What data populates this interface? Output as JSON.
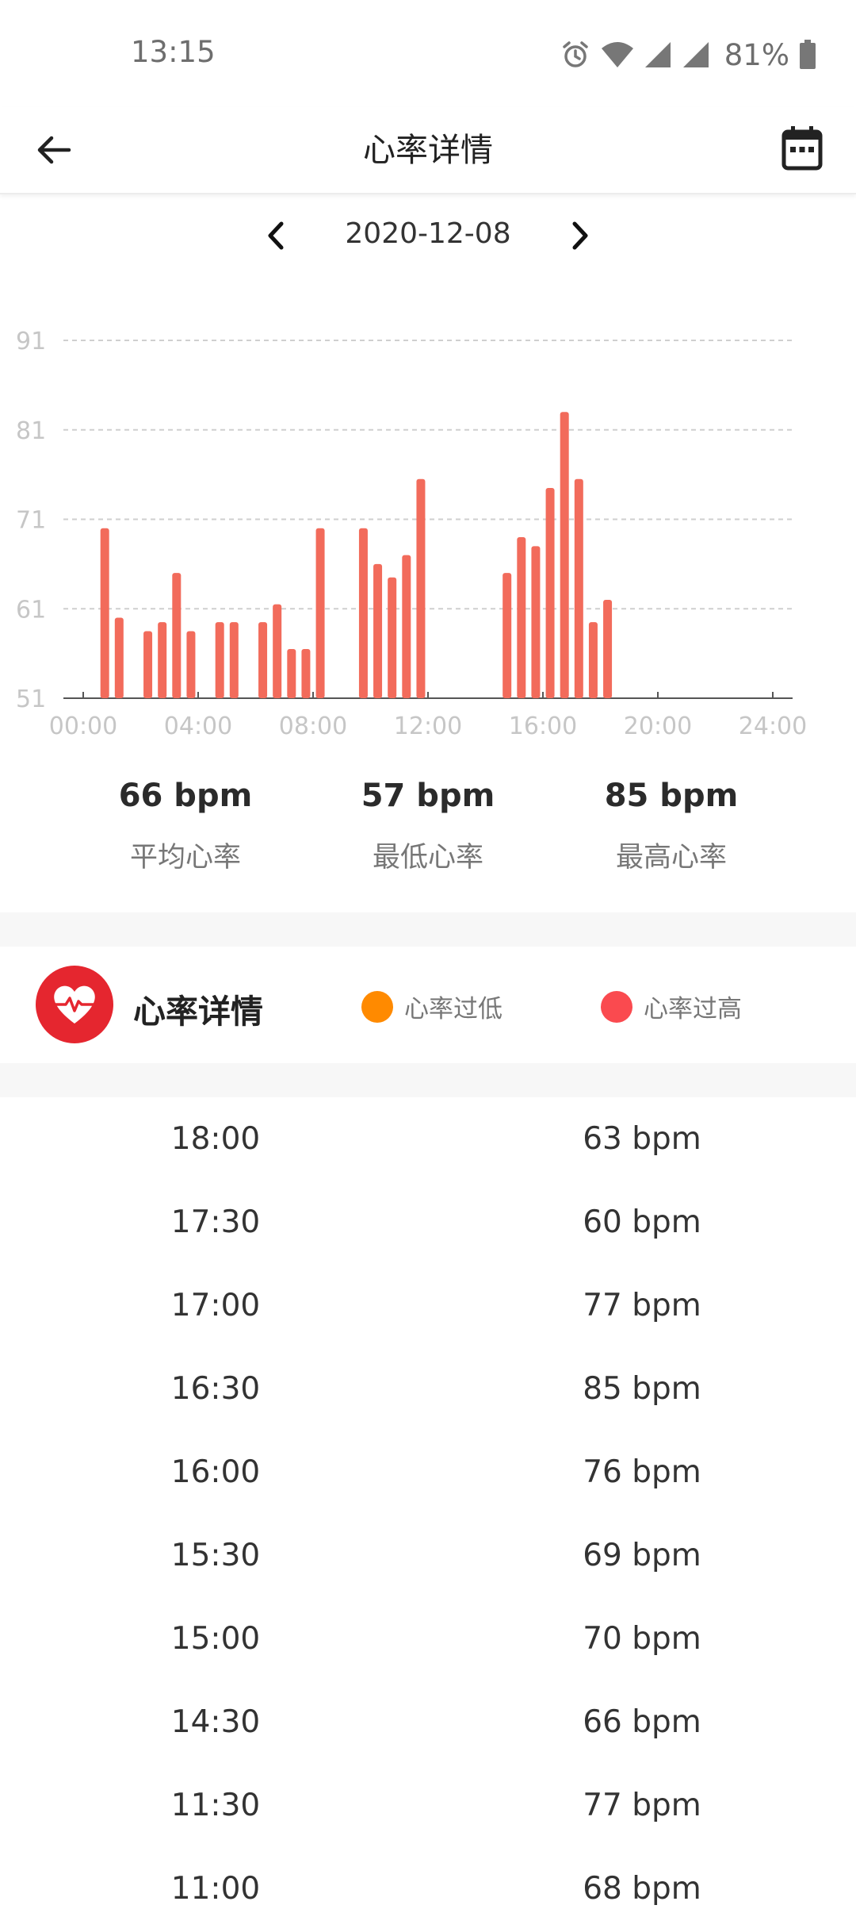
{
  "status_bar": {
    "time": "13:15",
    "battery": "81%",
    "icons": [
      "alarm-icon",
      "wifi-icon",
      "signal-icon",
      "signal-icon",
      "battery-icon"
    ]
  },
  "app_bar": {
    "title": "心率详情",
    "back_icon": "arrow-left-icon",
    "calendar_icon": "calendar-icon"
  },
  "date_nav": {
    "date": "2020-12-08",
    "prev_icon": "chevron-left-icon",
    "next_icon": "chevron-right-icon"
  },
  "chart_data": {
    "type": "bar",
    "x_unit": "hours",
    "x_range": [
      0,
      24
    ],
    "x_ticks": [
      "00:00",
      "04:00",
      "08:00",
      "12:00",
      "16:00",
      "20:00",
      "24:00"
    ],
    "y_ticks": [
      "51",
      "61",
      "71",
      "81",
      "91"
    ],
    "ylim": [
      51,
      91
    ],
    "grid": true,
    "bar_color": "#f26b5b",
    "series": [
      {
        "points": [
          {
            "x": 0.75,
            "y": 70
          },
          {
            "x": 1.25,
            "y": 60
          },
          {
            "x": 2.25,
            "y": 58.5
          },
          {
            "x": 2.75,
            "y": 59.5
          },
          {
            "x": 3.25,
            "y": 65
          },
          {
            "x": 3.75,
            "y": 58.5
          },
          {
            "x": 4.75,
            "y": 59.5
          },
          {
            "x": 5.25,
            "y": 59.5
          },
          {
            "x": 6.25,
            "y": 59.5
          },
          {
            "x": 6.75,
            "y": 61.5
          },
          {
            "x": 7.25,
            "y": 56.5
          },
          {
            "x": 7.75,
            "y": 56.5
          },
          {
            "x": 8.25,
            "y": 70
          },
          {
            "x": 9.75,
            "y": 70
          },
          {
            "x": 10.25,
            "y": 66
          },
          {
            "x": 10.75,
            "y": 64.5
          },
          {
            "x": 11.25,
            "y": 67
          },
          {
            "x": 11.75,
            "y": 75.5
          },
          {
            "x": 14.75,
            "y": 65
          },
          {
            "x": 15.25,
            "y": 69
          },
          {
            "x": 15.75,
            "y": 68
          },
          {
            "x": 16.25,
            "y": 74.5
          },
          {
            "x": 16.75,
            "y": 83
          },
          {
            "x": 17.25,
            "y": 75.5
          },
          {
            "x": 17.75,
            "y": 59.5
          },
          {
            "x": 18.25,
            "y": 62
          }
        ]
      }
    ]
  },
  "stats": [
    {
      "value": "66 bpm",
      "label": "平均心率"
    },
    {
      "value": "57 bpm",
      "label": "最低心率"
    },
    {
      "value": "85 bpm",
      "label": "最高心率"
    }
  ],
  "detail": {
    "title": "心率详情",
    "icon": "heart-pulse-icon",
    "legend": [
      {
        "label": "心率过低",
        "color": "#ff8a00"
      },
      {
        "label": "心率过高",
        "color": "#fa4a4f"
      }
    ]
  },
  "records": [
    {
      "time": "18:00",
      "value": "63 bpm"
    },
    {
      "time": "17:30",
      "value": "60 bpm"
    },
    {
      "time": "17:00",
      "value": "77 bpm"
    },
    {
      "time": "16:30",
      "value": "85 bpm"
    },
    {
      "time": "16:00",
      "value": "76 bpm"
    },
    {
      "time": "15:30",
      "value": "69 bpm"
    },
    {
      "time": "15:00",
      "value": "70 bpm"
    },
    {
      "time": "14:30",
      "value": "66 bpm"
    },
    {
      "time": "11:30",
      "value": "77 bpm"
    },
    {
      "time": "11:00",
      "value": "68 bpm"
    }
  ]
}
